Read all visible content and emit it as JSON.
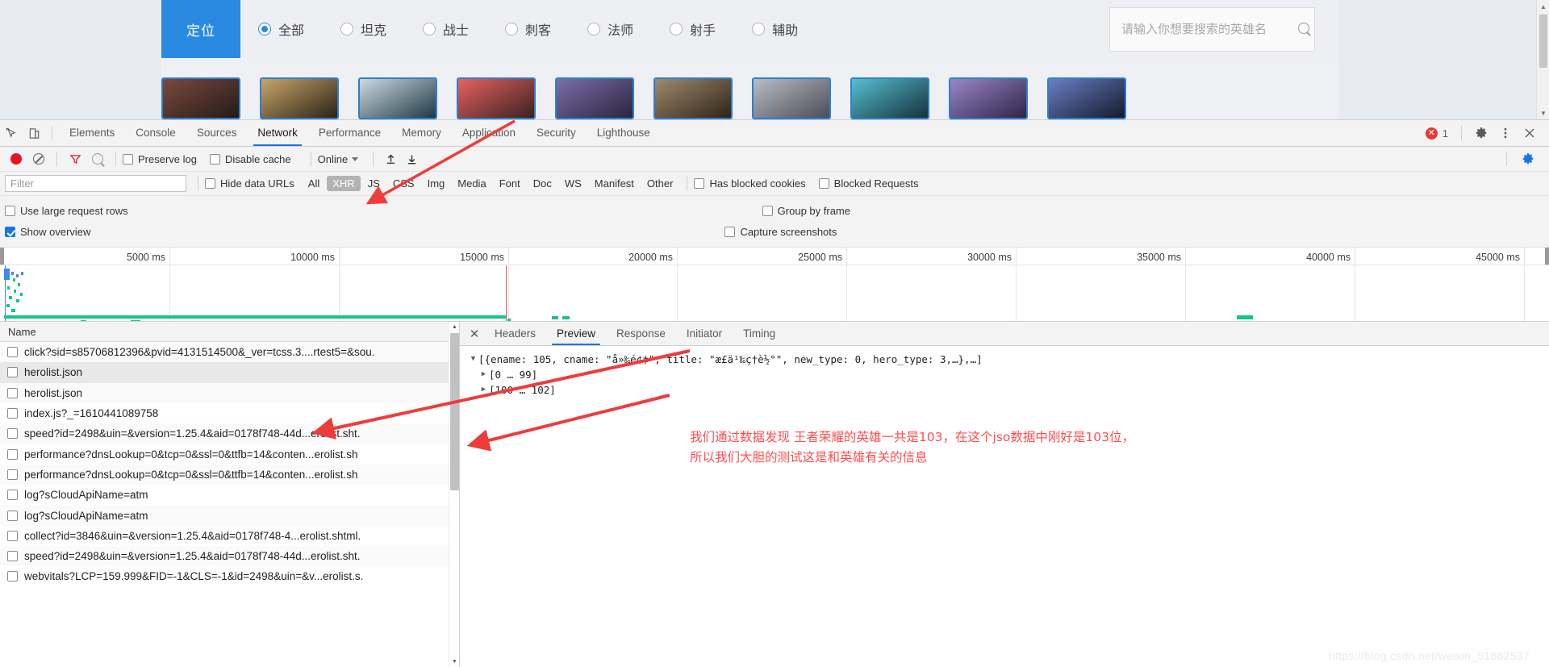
{
  "webpage": {
    "position_tag": "定位",
    "filters": [
      {
        "label": "全部",
        "checked": true
      },
      {
        "label": "坦克",
        "checked": false
      },
      {
        "label": "战士",
        "checked": false
      },
      {
        "label": "刺客",
        "checked": false
      },
      {
        "label": "法师",
        "checked": false
      },
      {
        "label": "射手",
        "checked": false
      },
      {
        "label": "辅助",
        "checked": false
      }
    ],
    "search": {
      "placeholder": "请输入你想要搜索的英雄名",
      "value": "",
      "icon": "search-icon"
    },
    "hero_cards": [
      {
        "c1": "#7a4a3e",
        "c2": "#241a18"
      },
      {
        "c1": "#caa66a",
        "c2": "#2b2216"
      },
      {
        "c1": "#cfd9df",
        "c2": "#1d3a46"
      },
      {
        "c1": "#e8615f",
        "c2": "#3a2220"
      },
      {
        "c1": "#7b6fa8",
        "c2": "#2a2440"
      },
      {
        "c1": "#a08a6e",
        "c2": "#2e2418"
      },
      {
        "c1": "#b9bcc4",
        "c2": "#4a4d55"
      },
      {
        "c1": "#56c0d0",
        "c2": "#16303c"
      },
      {
        "c1": "#9b86c8",
        "c2": "#2f2448"
      },
      {
        "c1": "#6a7ec4",
        "c2": "#141a2e"
      }
    ]
  },
  "devtools": {
    "main_tabs": [
      {
        "label": "Elements",
        "active": false
      },
      {
        "label": "Console",
        "active": false
      },
      {
        "label": "Sources",
        "active": false
      },
      {
        "label": "Network",
        "active": true
      },
      {
        "label": "Performance",
        "active": false
      },
      {
        "label": "Memory",
        "active": false
      },
      {
        "label": "Application",
        "active": false
      },
      {
        "label": "Security",
        "active": false
      },
      {
        "label": "Lighthouse",
        "active": false
      }
    ],
    "error_count": "1",
    "network_toolbar": {
      "record_title": "record",
      "clear_title": "clear",
      "filter_title": "filter",
      "search_title": "search",
      "preserve_log": {
        "label": "Preserve log",
        "checked": false
      },
      "disable_cache": {
        "label": "Disable cache",
        "checked": false
      },
      "throttle": "Online",
      "import_title": "import-har",
      "export_title": "export-har"
    },
    "filter_row": {
      "filter_placeholder": "Filter",
      "filter_value": "",
      "hide_data_urls": {
        "label": "Hide data URLs",
        "checked": false
      },
      "types": [
        {
          "label": "All",
          "active": false
        },
        {
          "label": "XHR",
          "active": true
        },
        {
          "label": "JS",
          "active": false
        },
        {
          "label": "CSS",
          "active": false
        },
        {
          "label": "Img",
          "active": false
        },
        {
          "label": "Media",
          "active": false
        },
        {
          "label": "Font",
          "active": false
        },
        {
          "label": "Doc",
          "active": false
        },
        {
          "label": "WS",
          "active": false
        },
        {
          "label": "Manifest",
          "active": false
        },
        {
          "label": "Other",
          "active": false
        }
      ],
      "has_blocked_cookies": {
        "label": "Has blocked cookies",
        "checked": false
      },
      "blocked_requests": {
        "label": "Blocked Requests",
        "checked": false
      }
    },
    "settings": {
      "use_large_request_rows": {
        "label": "Use large request rows",
        "checked": false
      },
      "show_overview": {
        "label": "Show overview",
        "checked": true
      },
      "group_by_frame": {
        "label": "Group by frame",
        "checked": false
      },
      "capture_screenshots": {
        "label": "Capture screenshots",
        "checked": false
      }
    },
    "overview": {
      "ticks": [
        "5000 ms",
        "10000 ms",
        "15000 ms",
        "20000 ms",
        "25000 ms",
        "30000 ms",
        "35000 ms",
        "40000 ms",
        "45000 ms"
      ]
    },
    "requests_header": "Name",
    "requests": [
      {
        "name": "click?sid=s85706812396&pvid=4131514500&_ver=tcss.3....rtest5=&sou.",
        "selected": false
      },
      {
        "name": "herolist.json",
        "selected": true
      },
      {
        "name": "herolist.json",
        "selected": false
      },
      {
        "name": "index.js?_=1610441089758",
        "selected": false
      },
      {
        "name": "speed?id=2498&uin=&version=1.25.4&aid=0178f748-44d...erolist.sht.",
        "selected": false
      },
      {
        "name": "performance?dnsLookup=0&tcp=0&ssl=0&ttfb=14&conten...erolist.sh",
        "selected": false
      },
      {
        "name": "performance?dnsLookup=0&tcp=0&ssl=0&ttfb=14&conten...erolist.sh",
        "selected": false
      },
      {
        "name": "log?sCloudApiName=atm",
        "selected": false
      },
      {
        "name": "log?sCloudApiName=atm",
        "selected": false
      },
      {
        "name": "collect?id=3846&uin=&version=1.25.4&aid=0178f748-4...erolist.shtml.",
        "selected": false
      },
      {
        "name": "speed?id=2498&uin=&version=1.25.4&aid=0178f748-44d...erolist.sht.",
        "selected": false
      },
      {
        "name": "webvitals?LCP=159.999&FID=-1&CLS=-1&id=2498&uin=&v...erolist.s.",
        "selected": false
      }
    ],
    "detail_tabs": [
      {
        "label": "Headers",
        "active": false
      },
      {
        "label": "Preview",
        "active": true
      },
      {
        "label": "Response",
        "active": false
      },
      {
        "label": "Initiator",
        "active": false
      },
      {
        "label": "Timing",
        "active": false
      }
    ],
    "preview": {
      "root_line": "[{ename: 105, cname: \"å»‰é¢‡\", title: \"æ£ä¹‰ç†è½°\", new_type: 0, hero_type: 3,…},…]",
      "child_lines": [
        "[0 … 99]",
        "[100 … 102]"
      ]
    }
  },
  "annotations": {
    "note": "我们通过数据发现 王者荣耀的英雄一共是103，在这个jso数据中刚好是103位，\n所以我们大胆的测试这是和英雄有关的信息",
    "note_color": "#ff4d4d"
  },
  "watermark": "https://blog.csdn.net/weixin_51662537"
}
